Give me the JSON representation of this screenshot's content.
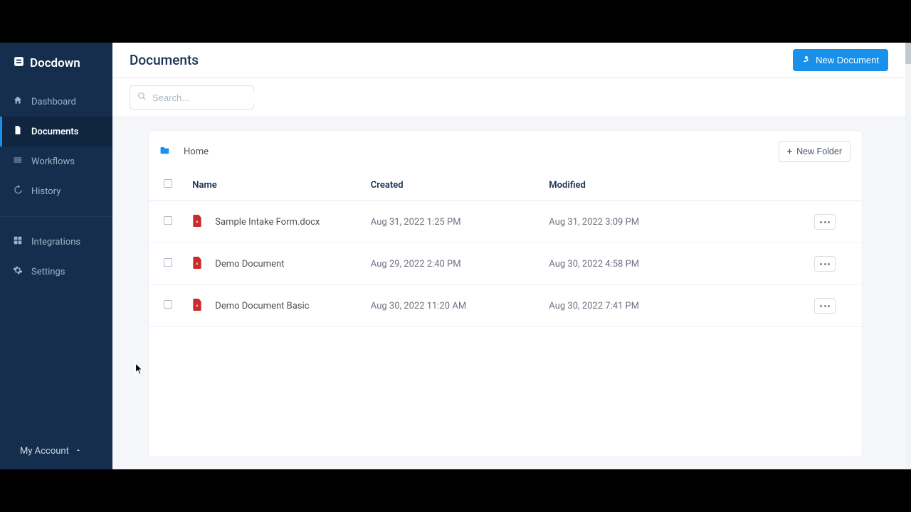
{
  "brand": "Docdown",
  "sidebar": {
    "items": [
      {
        "label": "Dashboard"
      },
      {
        "label": "Documents"
      },
      {
        "label": "Workflows"
      },
      {
        "label": "History"
      },
      {
        "label": "Integrations"
      },
      {
        "label": "Settings"
      }
    ],
    "my_account": "My Account"
  },
  "header": {
    "title": "Documents",
    "new_document": "New Document"
  },
  "search": {
    "placeholder": "Search..."
  },
  "breadcrumb": {
    "home": "Home",
    "new_folder": "New Folder"
  },
  "table": {
    "columns": {
      "name": "Name",
      "created": "Created",
      "modified": "Modified"
    },
    "rows": [
      {
        "name": "Sample Intake Form.docx",
        "created": "Aug 31, 2022 1:25 PM",
        "modified": "Aug 31, 2022 3:09 PM"
      },
      {
        "name": "Demo Document",
        "created": "Aug 29, 2022 2:40 PM",
        "modified": "Aug 30, 2022 4:58 PM"
      },
      {
        "name": "Demo Document Basic",
        "created": "Aug 30, 2022 11:20 AM",
        "modified": "Aug 30, 2022 7:41 PM"
      }
    ]
  }
}
